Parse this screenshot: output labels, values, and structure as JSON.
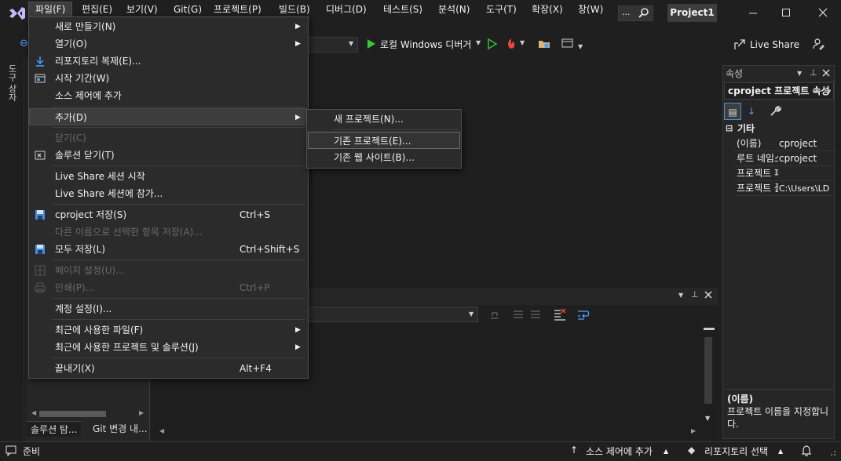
{
  "menubar": {
    "items": [
      {
        "label": "파일(F)"
      },
      {
        "label": "편집(E)"
      },
      {
        "label": "보기(V)"
      },
      {
        "label": "Git(G)"
      },
      {
        "label": "프로젝트(P)"
      },
      {
        "label": "빌드(B)"
      },
      {
        "label": "디버그(D)"
      },
      {
        "label": "테스트(S)"
      },
      {
        "label": "분석(N)"
      },
      {
        "label": "도구(T)"
      },
      {
        "label": "확장(X)"
      },
      {
        "label": "창(W)"
      }
    ],
    "search_label": "...",
    "project_badge": "Project1"
  },
  "toolbar": {
    "debug_target": "로컬 Windows 디버거",
    "live_share": "Live Share"
  },
  "toolstrip": {
    "label": "도구 상자"
  },
  "file_menu": {
    "items": [
      {
        "label": "새로 만들기(N)",
        "shortcut": "",
        "submenu": true,
        "disabled": false,
        "icon": ""
      },
      {
        "label": "열기(O)",
        "shortcut": "",
        "submenu": true,
        "disabled": false,
        "icon": ""
      },
      {
        "label": "리포지토리 복제(E)...",
        "shortcut": "",
        "submenu": false,
        "disabled": false,
        "icon": "download-icon"
      },
      {
        "label": "시작 기간(W)",
        "shortcut": "",
        "submenu": false,
        "disabled": false,
        "icon": "start-window-icon"
      },
      {
        "label": "소스 제어에 추가",
        "shortcut": "",
        "submenu": false,
        "disabled": false,
        "icon": ""
      },
      {
        "label": "추가(D)",
        "shortcut": "",
        "submenu": true,
        "disabled": false,
        "icon": ""
      },
      {
        "label": "닫기(C)",
        "shortcut": "",
        "submenu": false,
        "disabled": true,
        "icon": ""
      },
      {
        "label": "솔루션 닫기(T)",
        "shortcut": "",
        "submenu": false,
        "disabled": false,
        "icon": "close-solution-icon"
      },
      {
        "label": "Live Share 세션 시작",
        "shortcut": "",
        "submenu": false,
        "disabled": false,
        "icon": ""
      },
      {
        "label": "Live Share 세션에 참가...",
        "shortcut": "",
        "submenu": false,
        "disabled": false,
        "icon": ""
      },
      {
        "label": "cproject 저장(S)",
        "shortcut": "Ctrl+S",
        "submenu": false,
        "disabled": false,
        "icon": "save-icon"
      },
      {
        "label": "다른 이름으로 선택한 항목 저장(A)...",
        "shortcut": "",
        "submenu": false,
        "disabled": true,
        "icon": ""
      },
      {
        "label": "모두 저장(L)",
        "shortcut": "Ctrl+Shift+S",
        "submenu": false,
        "disabled": false,
        "icon": "save-all-icon"
      },
      {
        "label": "페이지 설정(U)...",
        "shortcut": "",
        "submenu": false,
        "disabled": true,
        "icon": "page-setup-icon"
      },
      {
        "label": "인쇄(P)...",
        "shortcut": "Ctrl+P",
        "submenu": false,
        "disabled": true,
        "icon": "print-icon"
      },
      {
        "label": "계정 설정(I)...",
        "shortcut": "",
        "submenu": false,
        "disabled": false,
        "icon": ""
      },
      {
        "label": "최근에 사용한 파일(F)",
        "shortcut": "",
        "submenu": true,
        "disabled": false,
        "icon": ""
      },
      {
        "label": "최근에 사용한 프로젝트 및 솔루션(J)",
        "shortcut": "",
        "submenu": true,
        "disabled": false,
        "icon": ""
      },
      {
        "label": "끝내기(X)",
        "shortcut": "Alt+F4",
        "submenu": false,
        "disabled": false,
        "icon": ""
      }
    ]
  },
  "add_submenu": {
    "items": [
      {
        "label": "새 프로젝트(N)..."
      },
      {
        "label": "기존 프로젝트(E)..."
      },
      {
        "label": "기존 웹 사이트(B)..."
      }
    ]
  },
  "solution_explorer": {
    "tabs": [
      "솔루션 탐...",
      "Git 변경 내..."
    ]
  },
  "properties": {
    "title": "속성",
    "object": "cproject 프로젝트 속성",
    "category": "기타",
    "rows": [
      {
        "key": "(이름)",
        "value": "cproject"
      },
      {
        "key": "루트 네임스페이스",
        "value": "cproject"
      },
      {
        "key": "프로젝트 파일",
        "value": ""
      },
      {
        "key": "프로젝트 폴더",
        "value": "C:\\Users\\LD"
      }
    ],
    "desc_title": "(이름)",
    "desc_text": "프로젝트 이름을 지정합니다."
  },
  "statusbar": {
    "ready": "준비",
    "source_control": "소스 제어에 추가",
    "repo_select": "리포지토리 선택"
  }
}
